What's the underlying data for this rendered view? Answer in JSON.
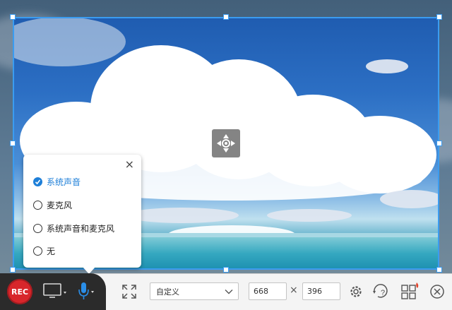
{
  "audio_popup": {
    "close_label": "×",
    "options": [
      {
        "label": "系统声音",
        "selected": true
      },
      {
        "label": "麦克风",
        "selected": false
      },
      {
        "label": "系统声音和麦克风",
        "selected": false
      },
      {
        "label": "无",
        "selected": false
      }
    ]
  },
  "toolbar": {
    "rec_label": "REC",
    "mode_select_value": "自定义",
    "width_value": "668",
    "height_value": "396",
    "times_symbol": "×",
    "icons": [
      "monitor-icon",
      "microphone-icon",
      "fullscreen-icon",
      "gear-icon",
      "help-icon",
      "grid-icon",
      "close-circle-icon"
    ]
  },
  "colors": {
    "accent": "#1e7fd8",
    "selection_border": "#3b9cf0",
    "rec": "#d8262b"
  }
}
